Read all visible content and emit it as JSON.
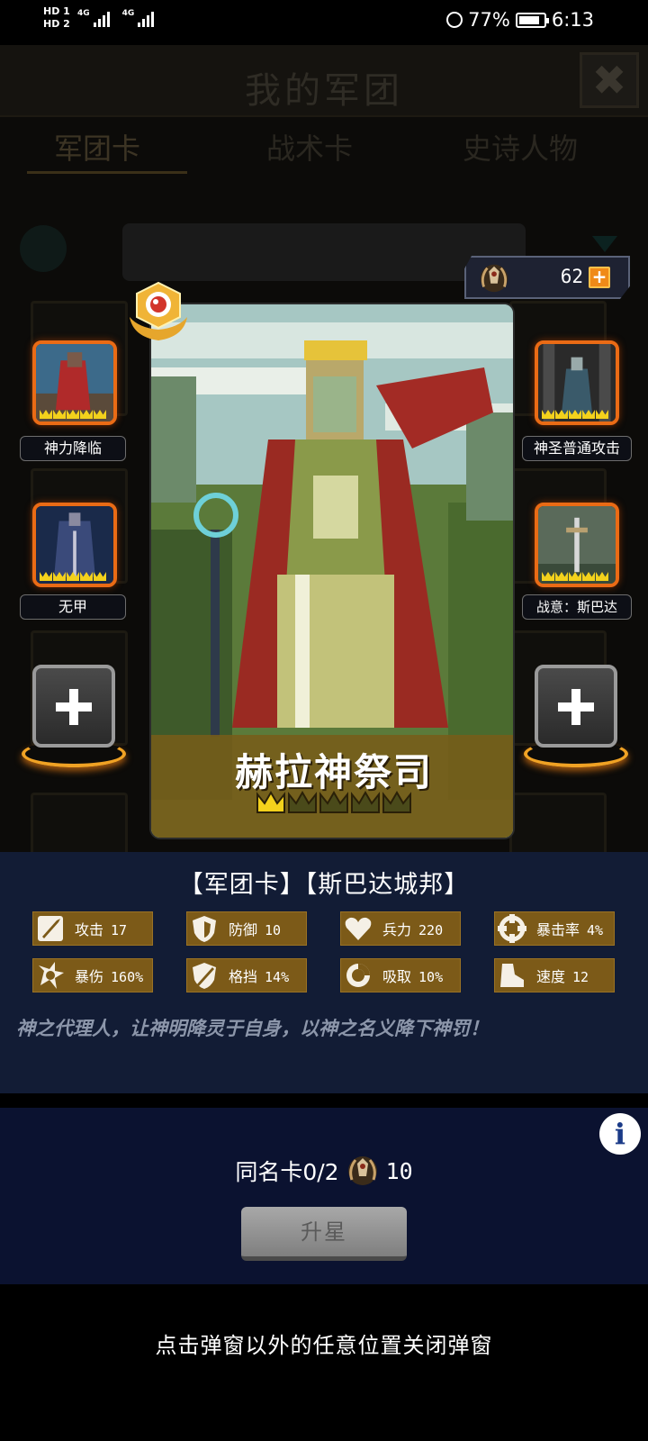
{
  "status_bar": {
    "hd1": "HD 1",
    "hd2": "HD 2",
    "net1": "4G",
    "net2": "4G",
    "battery_percent": "77%",
    "time": "6:13"
  },
  "background_screen": {
    "title": "我的军团",
    "close_label": "✖",
    "tabs": [
      "军团卡",
      "战术卡",
      "史诗人物"
    ],
    "active_tab": "军团卡"
  },
  "currency": {
    "value": "62",
    "add_label": "+"
  },
  "card": {
    "name": "赫拉神祭司",
    "star_level": 1,
    "max_stars": 5,
    "type_line": "【军团卡】【斯巴达城邦】",
    "description": "神之代理人，让神明降灵于自身，以神之名义降下神罚！"
  },
  "skills": {
    "left": [
      {
        "label": "神力降临",
        "crowns": 5
      },
      {
        "label": "无甲",
        "crowns": 5
      }
    ],
    "right": [
      {
        "label": "神圣普通攻击",
        "crowns": 5
      },
      {
        "label": "战意：斯巴达",
        "crowns": 5
      }
    ]
  },
  "stats": [
    {
      "icon": "sword-icon",
      "label": "攻击",
      "value": "17"
    },
    {
      "icon": "shield-icon",
      "label": "防御",
      "value": "10"
    },
    {
      "icon": "heart-icon",
      "label": "兵力",
      "value": "220"
    },
    {
      "icon": "crosshair-icon",
      "label": "暴击率",
      "value": "4%"
    },
    {
      "icon": "burst-icon",
      "label": "暴伤",
      "value": "160%"
    },
    {
      "icon": "block-shield-icon",
      "label": "格挡",
      "value": "14%"
    },
    {
      "icon": "absorb-icon",
      "label": "吸取",
      "value": "10%"
    },
    {
      "icon": "boot-icon",
      "label": "速度",
      "value": "12"
    }
  ],
  "upgrade": {
    "dup_label": "同名卡0/2",
    "cost": "10",
    "button_label": "升星",
    "info_label": "i"
  },
  "hint": "点击弹窗以外的任意位置关闭弹窗",
  "colors": {
    "accent_orange": "#ea6b15",
    "stat_bg": "#7c5a18",
    "panel_bg": "#121c35",
    "gold": "#f3d11c"
  }
}
